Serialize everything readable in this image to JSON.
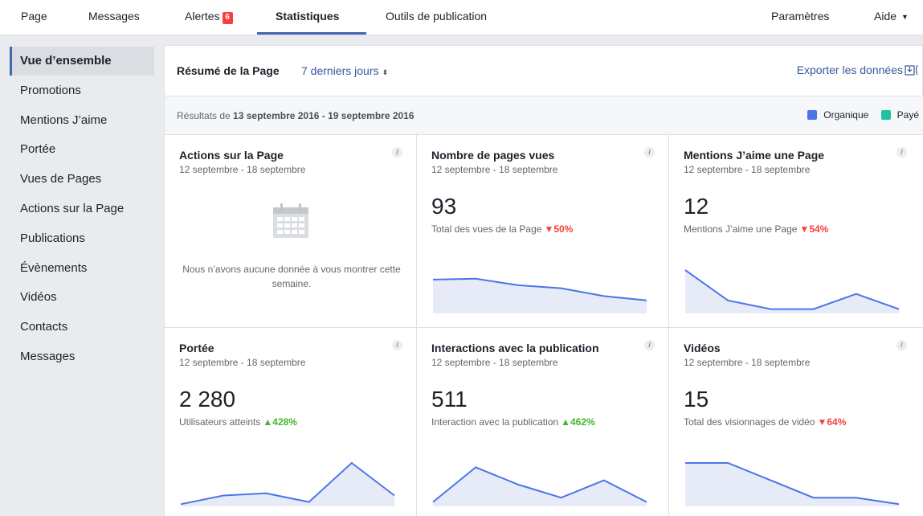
{
  "nav": {
    "page": "Page",
    "messages": "Messages",
    "alerts": "Alertes",
    "alerts_count": "6",
    "stats": "Statistiques",
    "publishing_tools": "Outils de publication",
    "settings": "Paramètres",
    "help": "Aide"
  },
  "sidebar": {
    "items": [
      {
        "label": "Vue d’ensemble"
      },
      {
        "label": "Promotions"
      },
      {
        "label": "Mentions J’aime"
      },
      {
        "label": "Portée"
      },
      {
        "label": "Vues de Pages"
      },
      {
        "label": "Actions sur la Page"
      },
      {
        "label": "Publications"
      },
      {
        "label": "Évènements"
      },
      {
        "label": "Vidéos"
      },
      {
        "label": "Contacts"
      },
      {
        "label": "Messages"
      }
    ]
  },
  "summary": {
    "title": "Résumé de la Page",
    "period": "7 derniers jours",
    "export": "Exporter les données",
    "results_prefix": "Résultats de",
    "results_range": "13 septembre 2016 - 19 septembre 2016",
    "legend_organic": "Organique",
    "legend_paid": "Payé"
  },
  "colors": {
    "accent": "#4267b2",
    "organic": "#4a76e8",
    "paid": "#20c1a0",
    "down": "#fa3e3e",
    "up": "#42b72a"
  },
  "cards": [
    {
      "title": "Actions sur la Page",
      "date": "12 septembre - 18 septembre",
      "nodata": "Nous n’avons aucune donnée à vous montrer cette semaine.",
      "icon": "calendar-icon"
    },
    {
      "title": "Nombre de pages vues",
      "date": "12 septembre - 18 septembre",
      "value": "93",
      "label": "Total des vues de la Page",
      "change": "50%",
      "direction": "down",
      "trend": [
        0.78,
        0.8,
        0.65,
        0.58,
        0.4,
        0.3
      ]
    },
    {
      "title": "Mentions J’aime une Page",
      "date": "12 septembre - 18 septembre",
      "value": "12",
      "label": "Mentions J’aime une Page",
      "change": "54%",
      "direction": "down",
      "trend": [
        1.0,
        0.3,
        0.1,
        0.1,
        0.45,
        0.1
      ]
    },
    {
      "title": "Portée",
      "date": "12 septembre - 18 septembre",
      "value": "2 280",
      "label": "Utilisateurs atteints",
      "change": "428%",
      "direction": "up",
      "trend": [
        0.05,
        0.25,
        0.3,
        0.1,
        1.0,
        0.25
      ]
    },
    {
      "title": "Interactions avec la publication",
      "date": "12 septembre - 18 septembre",
      "value": "511",
      "label": "Interaction avec la publication",
      "change": "462%",
      "direction": "up",
      "trend": [
        0.1,
        0.9,
        0.5,
        0.2,
        0.6,
        0.1
      ]
    },
    {
      "title": "Vidéos",
      "date": "12 septembre - 18 septembre",
      "value": "15",
      "label": "Total des visionnages de vidéo",
      "change": "64%",
      "direction": "down",
      "trend": [
        1.0,
        1.0,
        0.6,
        0.2,
        0.2,
        0.05
      ]
    }
  ]
}
